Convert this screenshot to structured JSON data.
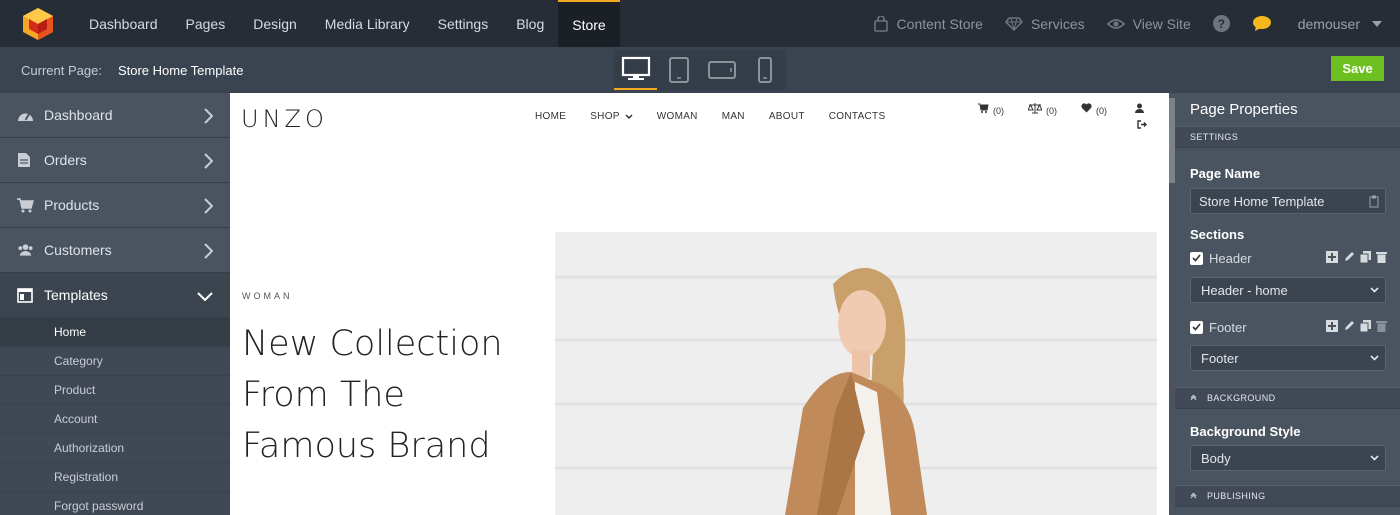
{
  "topbar": {
    "nav": [
      "Dashboard",
      "Pages",
      "Design",
      "Media Library",
      "Settings",
      "Blog",
      "Store"
    ],
    "active_nav": "Store",
    "content_store": "Content Store",
    "services": "Services",
    "view_site": "View Site",
    "help": "?",
    "username": "demouser"
  },
  "subbar": {
    "current_page_label": "Current Page:",
    "current_page_value": "Store Home Template",
    "save_label": "Save"
  },
  "sidebar": {
    "items": [
      {
        "label": "Dashboard",
        "icon": "dashboard-icon"
      },
      {
        "label": "Orders",
        "icon": "document-icon"
      },
      {
        "label": "Products",
        "icon": "cart-icon"
      },
      {
        "label": "Customers",
        "icon": "users-icon"
      },
      {
        "label": "Templates",
        "icon": "template-icon"
      }
    ],
    "template_subitems": [
      "Home",
      "Category",
      "Product",
      "Account",
      "Authorization",
      "Registration",
      "Forgot password"
    ],
    "active_subitem": "Home"
  },
  "site": {
    "brand": "UNZO",
    "nav": [
      "HOME",
      "SHOP",
      "WOMAN",
      "MAN",
      "ABOUT",
      "CONTACTS"
    ],
    "cart_count": "(0)",
    "compare_count": "(0)",
    "wishlist_count": "(0)",
    "eyebrow": "WOMAN",
    "hero_line1": "New Collection",
    "hero_line2": "From The",
    "hero_line3": "Famous Brand"
  },
  "panel": {
    "title": "Page Properties",
    "settings_header": "SETTINGS",
    "page_name_label": "Page Name",
    "page_name_value": "Store Home Template",
    "sections_label": "Sections",
    "header_check": "Header",
    "header_select": "Header - home",
    "footer_check": "Footer",
    "footer_select": "Footer",
    "background_header": "BACKGROUND",
    "bg_style_label": "Background Style",
    "bg_style_value": "Body",
    "publishing_header": "PUBLISHING"
  },
  "colors": {
    "accent": "#f5a623",
    "save": "#6cc01f",
    "topbar": "#262d36"
  }
}
